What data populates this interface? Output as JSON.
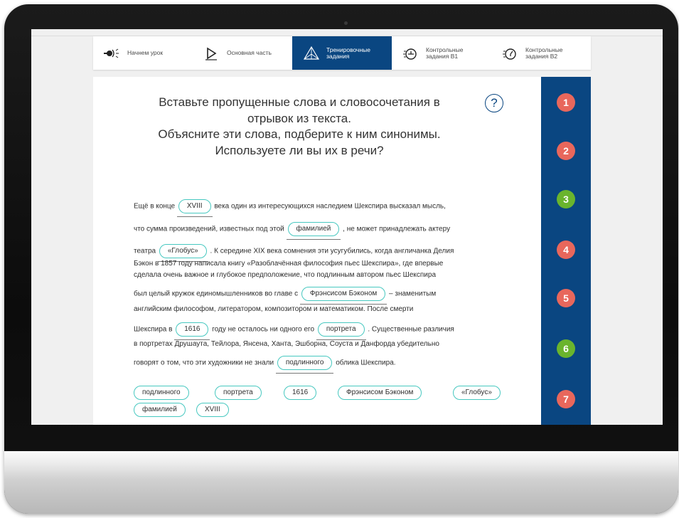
{
  "nav": [
    {
      "label": "Начнем урок",
      "icon": "whistle-icon",
      "active": false
    },
    {
      "label": "Основная часть",
      "icon": "play-screen-icon",
      "active": false
    },
    {
      "label": "Тренировочные\nзадания",
      "icon": "pyramid-icon",
      "active": true
    },
    {
      "label": "Контрольные\nзадания В1",
      "icon": "timer-b1-icon",
      "active": false
    },
    {
      "label": "Контрольные\nзадания В2",
      "icon": "timer-b2-icon",
      "active": false
    }
  ],
  "task": {
    "title_lines": [
      "Вставьте пропущенные слова и словосочетания в",
      "отрывок из текста.",
      "Объясните эти слова, подберите к ним синонимы.",
      "Используете ли вы их в речи?"
    ],
    "help": "?"
  },
  "text": {
    "l1a": "Ещё в конце",
    "b1": "XVIII",
    "l1b": "века один из интересующихся наследием Шекспира высказал мысль,",
    "l2a": "что сумма произведений, известных под этой",
    "b2": "фамилией",
    "l2b": ", не может принадлежать актеру",
    "l3a": "театра",
    "b3": "«Глобус»",
    "l3b": ". К середине XIX века сомнения эти усугубились, когда англичанка Делия",
    "l4": "Бэкон в 1857 году написала книгу «Разоблачённая философия пьес Шекспира», где впервые",
    "l5": "сделала очень важное и глубокое предположение, что подлинным автором пьес Шекспира",
    "l6a": "был целый кружок единомышленников во главе с",
    "b4": "Фрэнсисом Бэконом",
    "l6b": "– знаменитым",
    "l7": "английским философом, литератором, композитором и математиком. После смерти",
    "l8a": "Шекспира в",
    "b5": "1616",
    "l8b": "году не осталось ни одного его",
    "b6": "портрета",
    "l8c": ". Существенные различия",
    "l9": "в портретах Друшаута, Тейлора, Янсена, Ханта, Эшборна, Соуста и Данфорда убедительно",
    "l10a": "говорят о том, что эти художники не знали",
    "b7": "подлинного",
    "l10b": "облика Шекспира."
  },
  "options": [
    "подлинного",
    "портрета",
    "1616",
    "Фрэнсисом Бэконом",
    "«Глобус»",
    "фамилией",
    "XVIII"
  ],
  "side_numbers": [
    {
      "n": "1",
      "color": "#e8675c"
    },
    {
      "n": "2",
      "color": "#e8675c"
    },
    {
      "n": "3",
      "color": "#6ab42d"
    },
    {
      "n": "4",
      "color": "#e8675c"
    },
    {
      "n": "5",
      "color": "#e8675c"
    },
    {
      "n": "6",
      "color": "#6ab42d"
    },
    {
      "n": "7",
      "color": "#e8675c"
    }
  ]
}
